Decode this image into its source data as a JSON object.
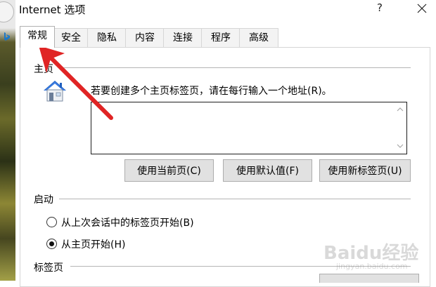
{
  "window": {
    "title": "Internet 选项",
    "help": "?"
  },
  "tabs": [
    {
      "label": "常规",
      "active": true
    },
    {
      "label": "安全",
      "active": false
    },
    {
      "label": "隐私",
      "active": false
    },
    {
      "label": "内容",
      "active": false
    },
    {
      "label": "连接",
      "active": false
    },
    {
      "label": "程序",
      "active": false
    },
    {
      "label": "高级",
      "active": false
    }
  ],
  "homepage": {
    "section_label": "主页",
    "description": "若要创建多个主页标签页，请在每行输入一个地址(R)。",
    "url_value": "",
    "buttons": {
      "use_current": "使用当前页(C)",
      "use_default": "使用默认值(F)",
      "use_new_tab": "使用新标签页(U)"
    }
  },
  "startup": {
    "section_label": "启动",
    "options": [
      {
        "label": "从上次会话中的标签页开始(B)",
        "selected": false
      },
      {
        "label": "从主页开始(H)",
        "selected": true
      }
    ]
  },
  "tabs_section": {
    "section_label": "标签页"
  },
  "watermark": {
    "text": "Baidu经验",
    "sub": "jingyan.baidu.com"
  },
  "colors": {
    "annotation_arrow": "#e02424",
    "window_bg": "#ffffff",
    "button_bg": "#e1e1e1"
  },
  "icons": [
    "help-icon",
    "close-icon",
    "home-icon",
    "scroll-up-icon",
    "scroll-down-icon",
    "bing-icon"
  ]
}
